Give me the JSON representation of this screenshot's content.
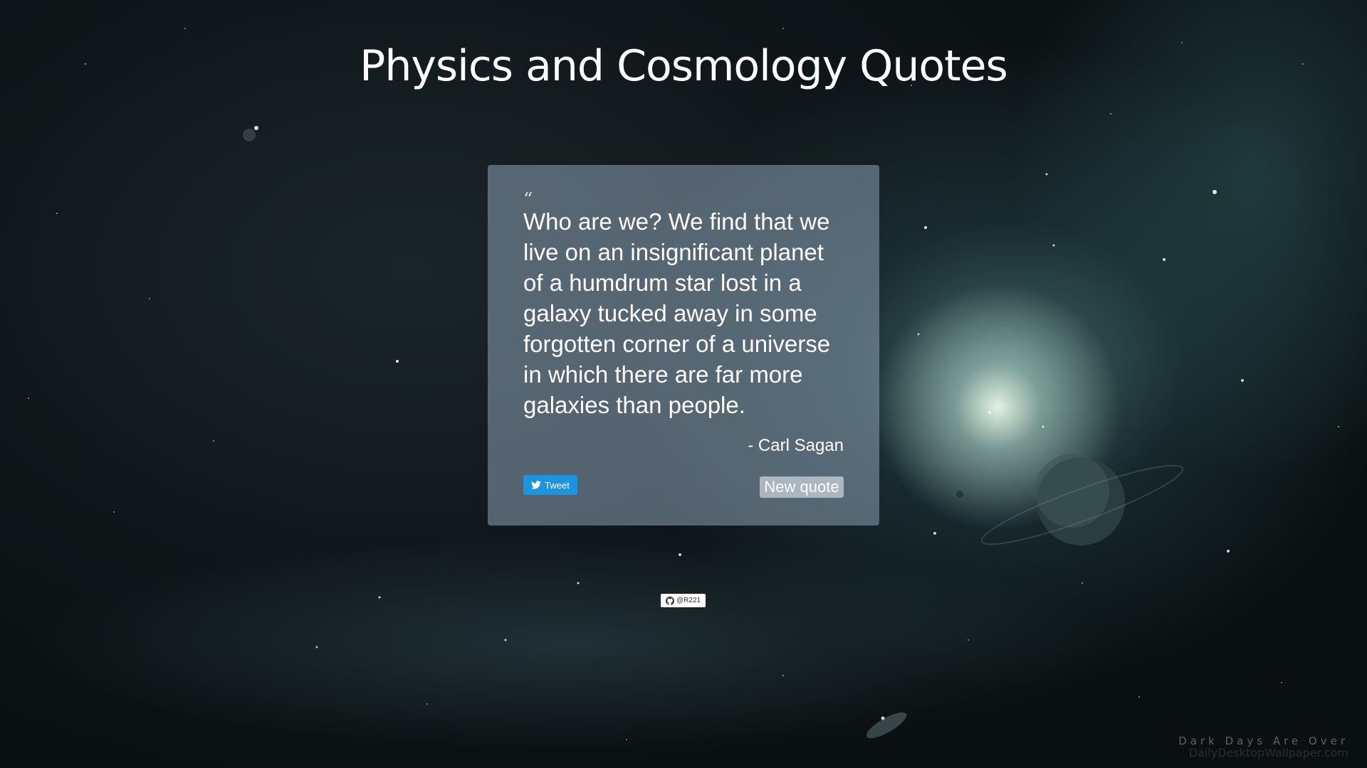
{
  "page": {
    "title": "Physics and Cosmology Quotes"
  },
  "quote": {
    "icon": "quote-left-icon",
    "text": "Who are we? We find that we live on an insignificant planet of a humdrum star lost in a galaxy tucked away in some forgotten corner of a universe in which there are far more galaxies than people.",
    "author": "- Carl Sagan"
  },
  "actions": {
    "tweet_label": "Tweet",
    "tweet_icon": "twitter-bird-icon",
    "new_quote_label": "New quote"
  },
  "github": {
    "icon": "github-icon",
    "label": "@R221"
  },
  "watermark": {
    "top": "Dark Days Are Over",
    "bottom": "DailyDesktopWallpaper.com"
  },
  "colors": {
    "tweet": "#1b95e0",
    "card": "rgba(140,160,180,0.55)"
  }
}
